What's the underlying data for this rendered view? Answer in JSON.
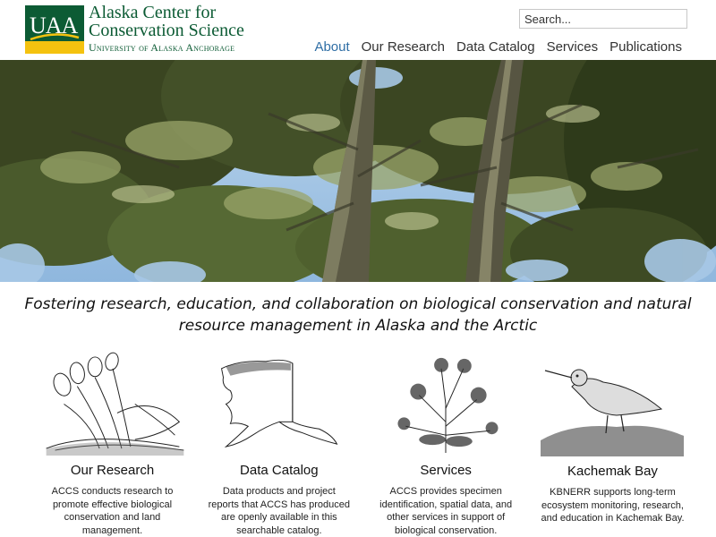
{
  "header": {
    "logo_mark": "UAA",
    "org_name": "Alaska Center for Conservation Science",
    "university": "University of Alaska Anchorage",
    "search_placeholder": "Search..."
  },
  "nav": [
    {
      "label": "About",
      "active": true
    },
    {
      "label": "Our Research",
      "active": false
    },
    {
      "label": "Data Catalog",
      "active": false
    },
    {
      "label": "Services",
      "active": false
    },
    {
      "label": "Publications",
      "active": false
    }
  ],
  "tagline": "Fostering research, education, and collaboration on biological conservation and natural resource management in Alaska and the Arctic",
  "features": [
    {
      "title": "Our Research",
      "text": "ACCS conducts research to promote effective biological conservation and land management.",
      "icon": "plant-sketch-icon"
    },
    {
      "title": "Data Catalog",
      "text": "Data products and project reports that ACCS has produced are openly available in this searchable catalog.",
      "icon": "alaska-map-icon"
    },
    {
      "title": "Services",
      "text": "ACCS provides specimen identification, spatial data, and other services in support of biological conservation.",
      "icon": "flower-sketch-icon"
    },
    {
      "title": "Kachemak Bay",
      "text": "KBNERR supports long-term ecosystem monitoring, research, and education in Kachemak Bay.",
      "icon": "shorebird-sketch-icon"
    }
  ],
  "colors": {
    "brand_green": "#0c5b34",
    "brand_gold": "#f4c20f",
    "nav_active": "#2f6ea5"
  }
}
